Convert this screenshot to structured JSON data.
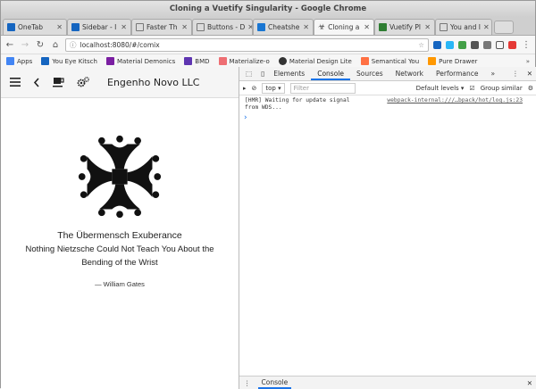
{
  "window": {
    "title": "Cloning a Vuetify Singularity - Google Chrome"
  },
  "tabs": [
    {
      "label": "OneTab",
      "color": "#1565c0"
    },
    {
      "label": "Sidebar - I",
      "color": "#1565c0"
    },
    {
      "label": "Faster Th",
      "color": "#777777"
    },
    {
      "label": "Buttons - D",
      "color": "#777777"
    },
    {
      "label": "Cheatshe",
      "color": "#1976d2"
    },
    {
      "label": "Cloning a",
      "color": "#444444",
      "active": true
    },
    {
      "label": "Vuetify Pl",
      "color": "#2e7d32"
    },
    {
      "label": "You and I",
      "color": "#777777"
    }
  ],
  "toolbar": {
    "url": "localhost:8080/#/comix"
  },
  "bookmarks": [
    {
      "label": "Apps",
      "color": "#4285f4"
    },
    {
      "label": "You Eye Kitsch",
      "color": "#1565c0"
    },
    {
      "label": "Material Demonics",
      "color": "#7b1fa2"
    },
    {
      "label": "BMD",
      "color": "#5e35b1"
    },
    {
      "label": "Materialize-o",
      "color": "#ee6e73"
    },
    {
      "label": "Material Design Lite",
      "color": "#333333"
    },
    {
      "label": "Semantical You",
      "color": "#ff7043"
    },
    {
      "label": "Pure Drawer",
      "color": "#ff9800"
    }
  ],
  "app": {
    "title": "Engenho Novo LLC",
    "quote_title": "The Übermensch Exuberance",
    "quote_body_line1": "Nothing Nietzsche Could Not Teach You About the",
    "quote_body_line2": "Bending of the Wrist",
    "quote_author": "— William Gates"
  },
  "devtools": {
    "tabs": [
      "Elements",
      "Console",
      "Sources",
      "Network",
      "Performance"
    ],
    "context": "top",
    "filter_placeholder": "Filter",
    "levels": "Default levels ▾",
    "group_similar": "Group similar",
    "message_line1": "[HMR] Waiting for update signal",
    "message_line2": "from WDS...",
    "message_source": "webpack-internal:///…bpack/hot/log.js:23",
    "drawer_tab": "Console"
  }
}
